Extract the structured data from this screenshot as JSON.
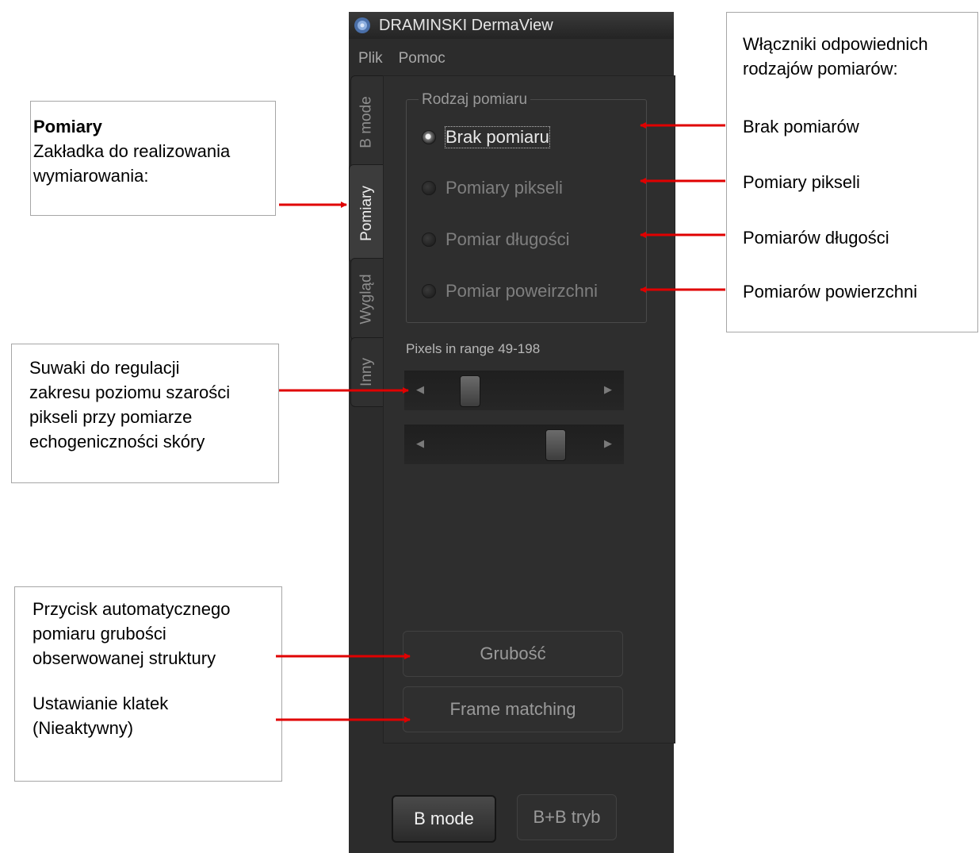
{
  "app": {
    "title": "DRAMINSKI DermaView",
    "menu": [
      "Plik",
      "Pomoc"
    ],
    "tabs": [
      "B mode",
      "Pomiary",
      "Wygląd",
      "Inny"
    ],
    "active_tab": "Pomiary",
    "group_title": "Rodzaj pomiaru",
    "radios": [
      {
        "label": "Brak pomiaru",
        "checked": true
      },
      {
        "label": "Pomiary pikseli",
        "checked": false
      },
      {
        "label": "Pomiar długości",
        "checked": false
      },
      {
        "label": "Pomiar poweirzchni",
        "checked": false
      }
    ],
    "range_label": "Pixels in range 49-198",
    "range_low": 49,
    "range_high": 198,
    "buttons": {
      "thickness": "Grubość",
      "frame_matching": "Frame matching",
      "bmode": "B mode",
      "bb_mode": "B+B tryb"
    }
  },
  "annotations": {
    "pomiary_title": "Pomiary",
    "pomiary_text": "Zakładka do realizowania\nwymiarowania:",
    "sliders_text": "Suwaki do regulacji\nzakresu poziomu szarości\npikseli przy pomiarze\nechogeniczności skóry",
    "thickness_text": "Przycisk automatycznego\npomiaru grubości\nobserwowanej struktury",
    "frames_text": "Ustawianie klatek\n(Nieaktywny)",
    "toggles_title": "Włączniki odpowiednich\nrodzajów pomiarów:",
    "toggle_labels": [
      "Brak pomiarów",
      "Pomiary pikseli",
      "Pomiarów długości",
      "Pomiarów powierzchni"
    ]
  },
  "colors": {
    "arrow": "#e00000",
    "window_bg": "#2c2c2c"
  }
}
